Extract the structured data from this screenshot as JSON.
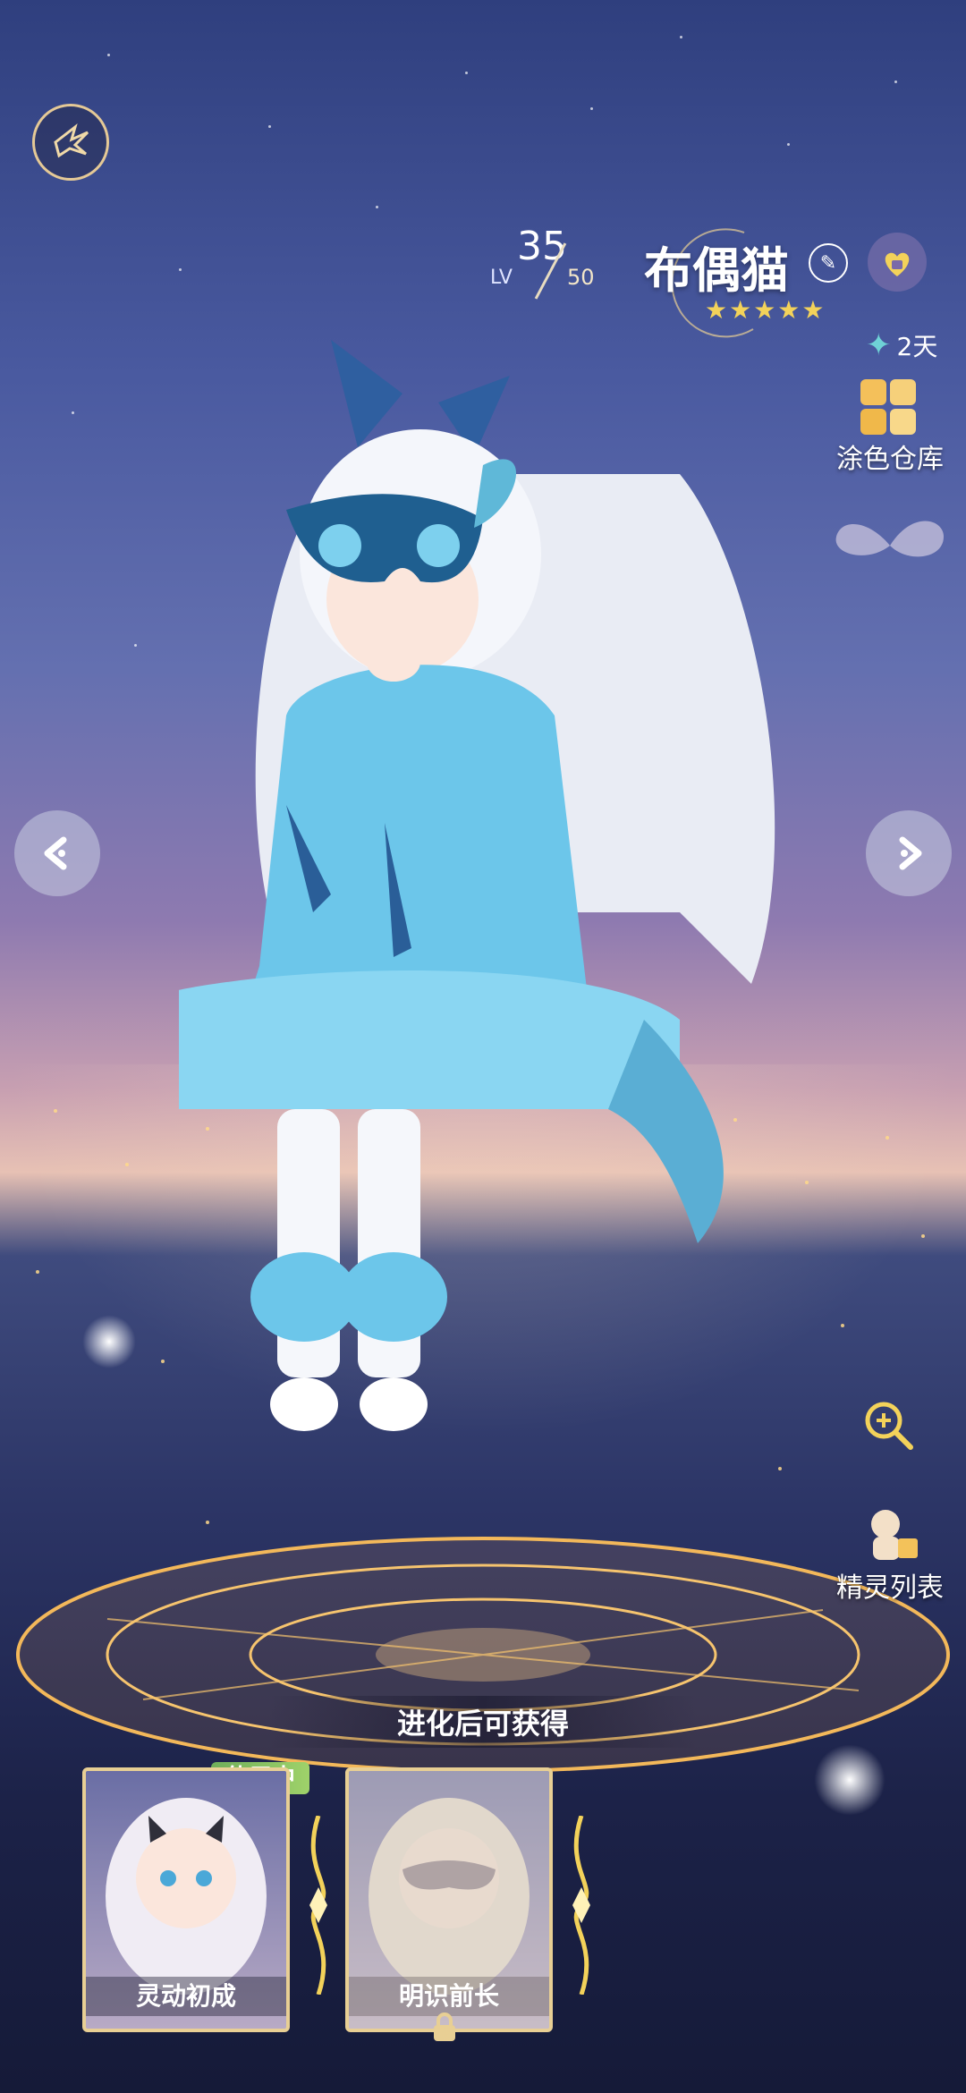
{
  "character": {
    "level_label": "LV",
    "level": "35",
    "max_level": "50",
    "name": "布偶猫",
    "star_count": 5
  },
  "side": {
    "timer": "2天",
    "color_storage": "涂色仓库",
    "spirit_list": "精灵列表"
  },
  "evolution": {
    "title": "进化后可获得",
    "in_use_badge": "使用中",
    "forms": [
      {
        "label": "灵动初成",
        "state": "in_use"
      },
      {
        "label": "明识前长",
        "state": "locked"
      }
    ]
  },
  "icons": {
    "top_left": "wing-emblem-icon",
    "edit": "pencil-icon",
    "lock": "heart-lock-icon",
    "timer": "sparkle-icon",
    "palette": "palette-grid-icon",
    "zoom": "zoom-in-icon",
    "spirit_list": "spirit-list-icon",
    "prev": "chevron-left-icon",
    "next": "chevron-right-icon"
  },
  "colors": {
    "accent_gold": "#e8cf94",
    "star_gold": "#f3d25a",
    "in_use_green": "#8ec862",
    "coat_blue": "#6cc6ea"
  }
}
